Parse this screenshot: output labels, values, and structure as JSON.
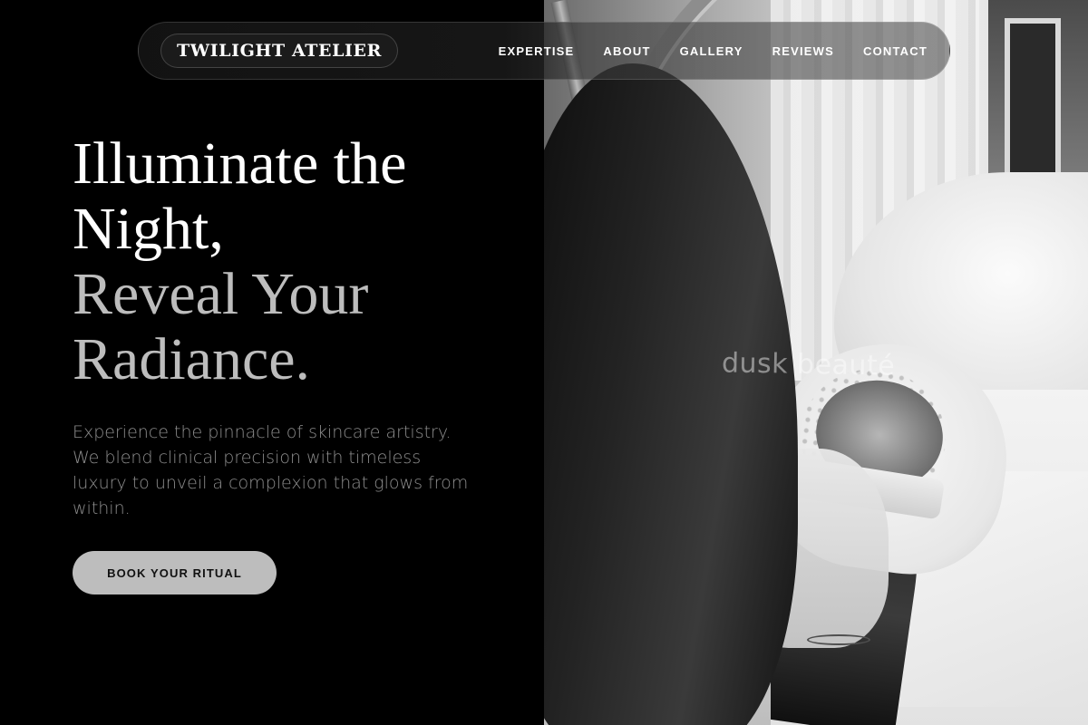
{
  "brand": {
    "name": "TWILIGHT ATELIER"
  },
  "nav": {
    "links": [
      "EXPERTISE",
      "ABOUT",
      "GALLERY",
      "REVIEWS",
      "CONTACT"
    ]
  },
  "hero": {
    "headline_line1": "Illuminate the Night,",
    "headline_line2": "Reveal Your Radiance.",
    "subcopy": "Experience the pinnacle of skincare artistry. We blend clinical precision with timeless luxury to unveil a complexion that glows from within.",
    "cta_label": "BOOK YOUR RITUAL"
  },
  "photo": {
    "watermark": "dusk beauté"
  },
  "colors": {
    "background": "#000000",
    "headline": "#ffffff",
    "headline_accent": "#bdbdbd",
    "subcopy": "#8e8e8e",
    "cta_bg": "#bdbdbd"
  }
}
